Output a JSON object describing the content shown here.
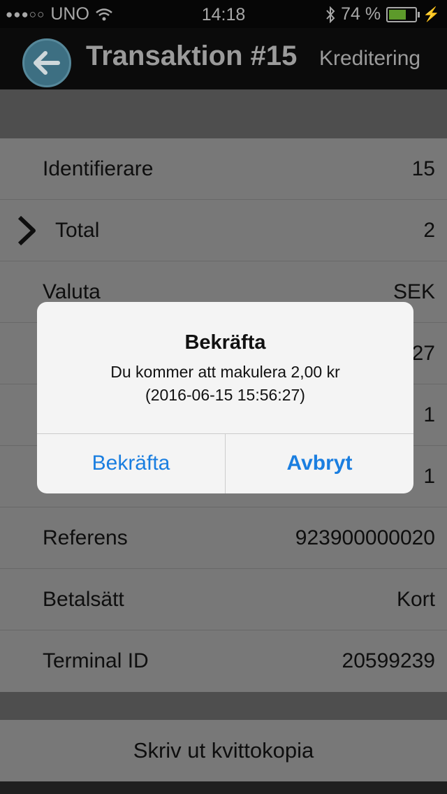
{
  "status": {
    "carrier": "UNO",
    "time": "14:18",
    "battery": "74 %",
    "battery_level": 0.74
  },
  "nav": {
    "title": "Transaktion #15",
    "subtitle": "Kreditering"
  },
  "rows": [
    {
      "label": "Identifierare",
      "value": "15"
    },
    {
      "label": "Total",
      "value": "2"
    },
    {
      "label": "Valuta",
      "value": "SEK"
    },
    {
      "label": "",
      "value": "27"
    },
    {
      "label": "",
      "value": "1"
    },
    {
      "label": "",
      "value": "1"
    },
    {
      "label": "Referens",
      "value": "923900000020"
    },
    {
      "label": "Betalsätt",
      "value": "Kort"
    },
    {
      "label": "Terminal ID",
      "value": "20599239"
    }
  ],
  "print_button": "Skriv ut kvittokopia",
  "dialog": {
    "title": "Bekräfta",
    "message_line1": "Du kommer att makulera 2,00 kr",
    "message_line2": "(2016-06-15 15:56:27)",
    "confirm": "Bekräfta",
    "cancel": "Avbryt"
  }
}
